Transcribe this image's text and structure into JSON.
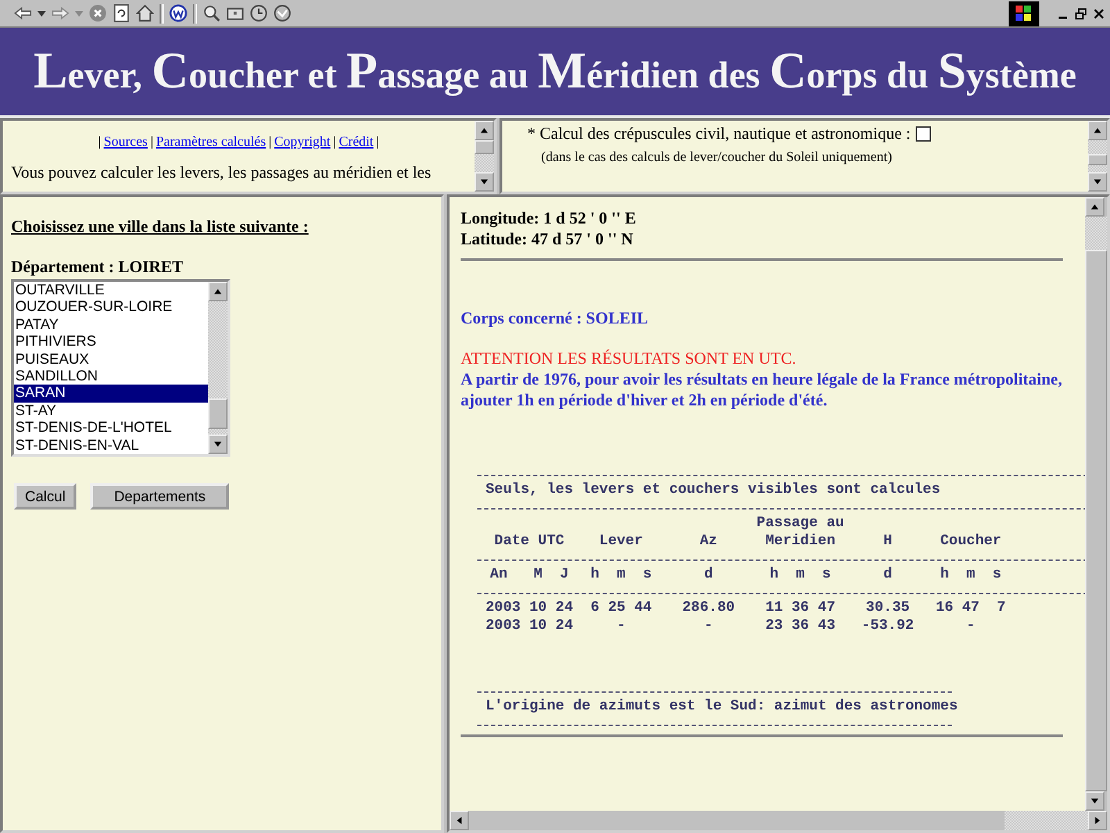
{
  "header": {
    "title": "Lever, Coucher et Passage au Méridien des Corps du Système"
  },
  "nav_frame": {
    "links": [
      {
        "kind": "sep",
        "text": "|"
      },
      {
        "kind": "link",
        "text": "Sources"
      },
      {
        "kind": "sep",
        "text": "|"
      },
      {
        "kind": "link",
        "text": "Paramètres calculés"
      },
      {
        "kind": "sep",
        "text": "|"
      },
      {
        "kind": "link",
        "text": "Copyright"
      },
      {
        "kind": "sep",
        "text": "|"
      },
      {
        "kind": "link",
        "text": "Crédit"
      },
      {
        "kind": "sep",
        "text": "|"
      }
    ],
    "intro": "Vous pouvez calculer les levers, les passages au méridien et les"
  },
  "options_frame": {
    "option": {
      "label": "* Calcul des crépuscules civil, nautique et astronomique :",
      "checked": false,
      "note": "(dans le cas des calculs de lever/coucher du Soleil uniquement)"
    }
  },
  "city_frame": {
    "heading": "Choisissez une ville dans la liste suivante :",
    "department": "Département : LOIRET",
    "cities": [
      {
        "name": "OUTARVILLE",
        "selected": false
      },
      {
        "name": "OUZOUER-SUR-LOIRE",
        "selected": false
      },
      {
        "name": "PATAY",
        "selected": false
      },
      {
        "name": "PITHIVIERS",
        "selected": false
      },
      {
        "name": "PUISEAUX",
        "selected": false
      },
      {
        "name": "SANDILLON",
        "selected": false
      },
      {
        "name": "SARAN",
        "selected": true
      },
      {
        "name": "ST-AY",
        "selected": false
      },
      {
        "name": "ST-DENIS-DE-L'HOTEL",
        "selected": false
      },
      {
        "name": "ST-DENIS-EN-VAL",
        "selected": false
      }
    ],
    "buttons": [
      "Calcul",
      "Departements"
    ]
  },
  "results_frame": {
    "longitude": "Longitude: 1 d 52 ' 0 '' E",
    "latitude": "Latitude: 47 d 57 ' 0 '' N",
    "body": "Corps concerné : SOLEIL",
    "warning": "ATTENTION LES RÉSULTATS SONT EN UTC.",
    "advice": "A partir de 1976, pour avoir les résultats en heure légale de la France métropolitaine, ajouter 1h en période d'hiver et 2h en période d'été.",
    "note": "Seuls, les levers et couchers visibles sont calcules",
    "table": {
      "columns": [
        "Date UTC",
        "Lever",
        "Az",
        "Passage au Meridien",
        "H",
        "Coucher"
      ],
      "units": [
        "An   M  J",
        "h  m  s",
        "d",
        "h  m  s",
        "d",
        "h  m  s"
      ],
      "rows": [
        [
          "2003 10 24",
          "6 25 44",
          "286.80",
          "11 36 47",
          "30.35",
          "16 47  7"
        ],
        [
          "2003 10 24",
          "-",
          "-",
          "23 36 43",
          "-53.92",
          "-"
        ]
      ]
    },
    "footer": "L'origine de azimuts est le Sud: azimut des astronomes"
  }
}
